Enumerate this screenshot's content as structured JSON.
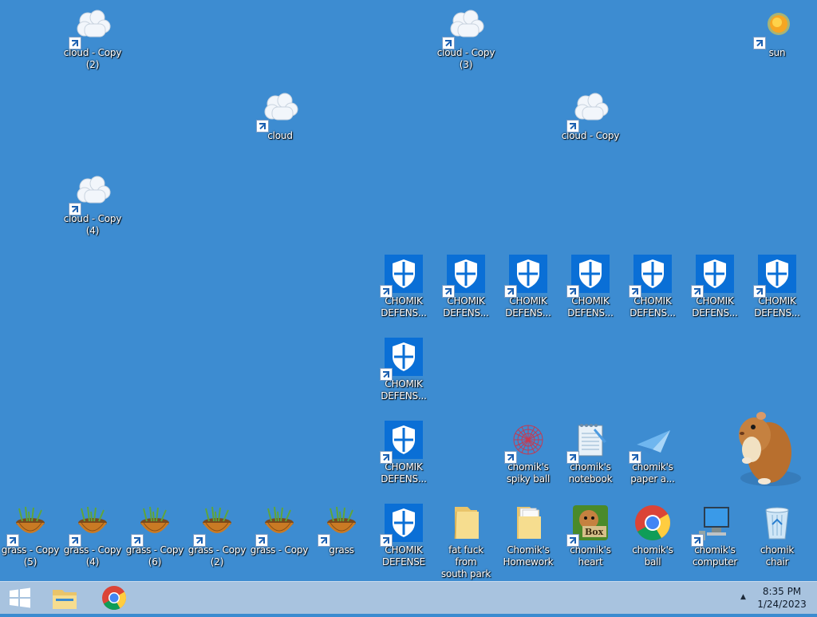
{
  "desktop": {
    "icons": [
      {
        "id": "cloud-copy-2",
        "label": "cloud - Copy\n(2)",
        "type": "cloud"
      },
      {
        "id": "cloud-copy-3",
        "label": "cloud - Copy\n(3)",
        "type": "cloud"
      },
      {
        "id": "sun",
        "label": "sun",
        "type": "sun"
      },
      {
        "id": "cloud",
        "label": "cloud",
        "type": "cloud"
      },
      {
        "id": "cloud-copy",
        "label": "cloud - Copy",
        "type": "cloud"
      },
      {
        "id": "cloud-copy-4",
        "label": "cloud - Copy\n(4)",
        "type": "cloud"
      },
      {
        "id": "chomik-defense-1",
        "label": "CHOMIK\nDEFENS...",
        "type": "shield"
      },
      {
        "id": "chomik-defense-2",
        "label": "CHOMIK\nDEFENS...",
        "type": "shield"
      },
      {
        "id": "chomik-defense-3",
        "label": "CHOMIK\nDEFENS...",
        "type": "shield"
      },
      {
        "id": "chomik-defense-4",
        "label": "CHOMIK\nDEFENS...",
        "type": "shield"
      },
      {
        "id": "chomik-defense-5",
        "label": "CHOMIK\nDEFENS...",
        "type": "shield"
      },
      {
        "id": "chomik-defense-6",
        "label": "CHOMIK\nDEFENS...",
        "type": "shield"
      },
      {
        "id": "chomik-defense-7",
        "label": "CHOMIK\nDEFENS...",
        "type": "shield"
      },
      {
        "id": "chomik-defense-8",
        "label": "CHOMIK\nDEFENS...",
        "type": "shield"
      },
      {
        "id": "chomik-defense-9",
        "label": "CHOMIK\nDEFENS...",
        "type": "shield"
      },
      {
        "id": "chomiks-spiky-ball",
        "label": "chomik's\nspiky ball",
        "type": "spiky"
      },
      {
        "id": "chomiks-notebook",
        "label": "chomik's\nnotebook",
        "type": "notebook"
      },
      {
        "id": "chomiks-paper-a",
        "label": "chomik's\npaper a...",
        "type": "paperplane"
      },
      {
        "id": "grass-copy-5",
        "label": "grass - Copy\n(5)",
        "type": "grass"
      },
      {
        "id": "grass-copy-4",
        "label": "grass - Copy\n(4)",
        "type": "grass"
      },
      {
        "id": "grass-copy-6",
        "label": "grass - Copy\n(6)",
        "type": "grass"
      },
      {
        "id": "grass-copy-2",
        "label": "grass - Copy\n(2)",
        "type": "grass"
      },
      {
        "id": "grass-copy",
        "label": "grass - Copy",
        "type": "grass"
      },
      {
        "id": "grass",
        "label": "grass",
        "type": "grass"
      },
      {
        "id": "chomik-defense",
        "label": "CHOMIK\nDEFENSE",
        "type": "shield"
      },
      {
        "id": "fat-fuck-from-south-park",
        "label": "fat fuck from\nsouth park",
        "type": "folder"
      },
      {
        "id": "chomiks-homework",
        "label": "Chomik's\nHomework",
        "type": "folder-docs"
      },
      {
        "id": "chomiks-heart",
        "label": "chomik's\nheart",
        "type": "box"
      },
      {
        "id": "chomiks-ball",
        "label": "chomik's ball",
        "type": "chrome"
      },
      {
        "id": "chomiks-computer",
        "label": "chomik's\ncomputer",
        "type": "computer"
      },
      {
        "id": "chomik-chair",
        "label": "chomik chair",
        "type": "recycle"
      }
    ]
  },
  "taskbar": {
    "pinned": [
      {
        "id": "start",
        "icon": "windows-logo-icon"
      },
      {
        "id": "explorer",
        "icon": "file-explorer-icon"
      },
      {
        "id": "chrome",
        "icon": "chrome-icon"
      }
    ],
    "tray_arrow": "▲",
    "clock_time": "8:35 PM",
    "clock_date": "1/24/2023"
  }
}
